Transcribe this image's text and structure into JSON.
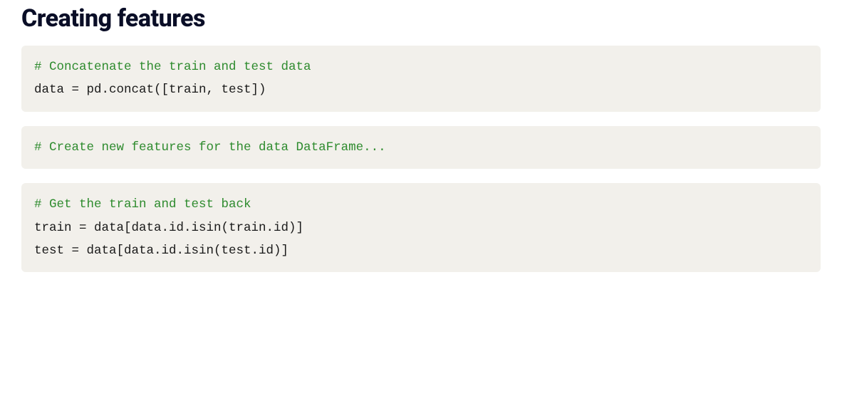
{
  "heading": "Creating features",
  "blocks": [
    {
      "lines": [
        {
          "type": "comment",
          "text": "# Concatenate the train and test data"
        },
        {
          "type": "code",
          "text": "data = pd.concat([train, test])"
        }
      ]
    },
    {
      "lines": [
        {
          "type": "comment",
          "text": "# Create new features for the data DataFrame..."
        }
      ]
    },
    {
      "lines": [
        {
          "type": "comment",
          "text": "# Get the train and test back"
        },
        {
          "type": "code",
          "text": "train = data[data.id.isin(train.id)]"
        },
        {
          "type": "code",
          "text": "test = data[data.id.isin(test.id)]"
        }
      ]
    }
  ]
}
